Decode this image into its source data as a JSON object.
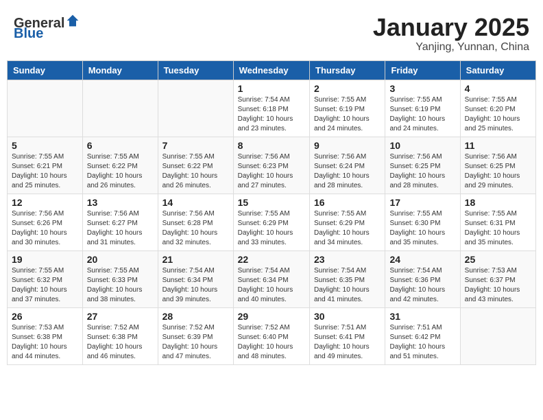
{
  "header": {
    "logo_general": "General",
    "logo_blue": "Blue",
    "month_title": "January 2025",
    "subtitle": "Yanjing, Yunnan, China"
  },
  "weekdays": [
    "Sunday",
    "Monday",
    "Tuesday",
    "Wednesday",
    "Thursday",
    "Friday",
    "Saturday"
  ],
  "weeks": [
    [
      {
        "day": "",
        "info": ""
      },
      {
        "day": "",
        "info": ""
      },
      {
        "day": "",
        "info": ""
      },
      {
        "day": "1",
        "info": "Sunrise: 7:54 AM\nSunset: 6:18 PM\nDaylight: 10 hours\nand 23 minutes."
      },
      {
        "day": "2",
        "info": "Sunrise: 7:55 AM\nSunset: 6:19 PM\nDaylight: 10 hours\nand 24 minutes."
      },
      {
        "day": "3",
        "info": "Sunrise: 7:55 AM\nSunset: 6:19 PM\nDaylight: 10 hours\nand 24 minutes."
      },
      {
        "day": "4",
        "info": "Sunrise: 7:55 AM\nSunset: 6:20 PM\nDaylight: 10 hours\nand 25 minutes."
      }
    ],
    [
      {
        "day": "5",
        "info": "Sunrise: 7:55 AM\nSunset: 6:21 PM\nDaylight: 10 hours\nand 25 minutes."
      },
      {
        "day": "6",
        "info": "Sunrise: 7:55 AM\nSunset: 6:22 PM\nDaylight: 10 hours\nand 26 minutes."
      },
      {
        "day": "7",
        "info": "Sunrise: 7:55 AM\nSunset: 6:22 PM\nDaylight: 10 hours\nand 26 minutes."
      },
      {
        "day": "8",
        "info": "Sunrise: 7:56 AM\nSunset: 6:23 PM\nDaylight: 10 hours\nand 27 minutes."
      },
      {
        "day": "9",
        "info": "Sunrise: 7:56 AM\nSunset: 6:24 PM\nDaylight: 10 hours\nand 28 minutes."
      },
      {
        "day": "10",
        "info": "Sunrise: 7:56 AM\nSunset: 6:25 PM\nDaylight: 10 hours\nand 28 minutes."
      },
      {
        "day": "11",
        "info": "Sunrise: 7:56 AM\nSunset: 6:25 PM\nDaylight: 10 hours\nand 29 minutes."
      }
    ],
    [
      {
        "day": "12",
        "info": "Sunrise: 7:56 AM\nSunset: 6:26 PM\nDaylight: 10 hours\nand 30 minutes."
      },
      {
        "day": "13",
        "info": "Sunrise: 7:56 AM\nSunset: 6:27 PM\nDaylight: 10 hours\nand 31 minutes."
      },
      {
        "day": "14",
        "info": "Sunrise: 7:56 AM\nSunset: 6:28 PM\nDaylight: 10 hours\nand 32 minutes."
      },
      {
        "day": "15",
        "info": "Sunrise: 7:55 AM\nSunset: 6:29 PM\nDaylight: 10 hours\nand 33 minutes."
      },
      {
        "day": "16",
        "info": "Sunrise: 7:55 AM\nSunset: 6:29 PM\nDaylight: 10 hours\nand 34 minutes."
      },
      {
        "day": "17",
        "info": "Sunrise: 7:55 AM\nSunset: 6:30 PM\nDaylight: 10 hours\nand 35 minutes."
      },
      {
        "day": "18",
        "info": "Sunrise: 7:55 AM\nSunset: 6:31 PM\nDaylight: 10 hours\nand 35 minutes."
      }
    ],
    [
      {
        "day": "19",
        "info": "Sunrise: 7:55 AM\nSunset: 6:32 PM\nDaylight: 10 hours\nand 37 minutes."
      },
      {
        "day": "20",
        "info": "Sunrise: 7:55 AM\nSunset: 6:33 PM\nDaylight: 10 hours\nand 38 minutes."
      },
      {
        "day": "21",
        "info": "Sunrise: 7:54 AM\nSunset: 6:34 PM\nDaylight: 10 hours\nand 39 minutes."
      },
      {
        "day": "22",
        "info": "Sunrise: 7:54 AM\nSunset: 6:34 PM\nDaylight: 10 hours\nand 40 minutes."
      },
      {
        "day": "23",
        "info": "Sunrise: 7:54 AM\nSunset: 6:35 PM\nDaylight: 10 hours\nand 41 minutes."
      },
      {
        "day": "24",
        "info": "Sunrise: 7:54 AM\nSunset: 6:36 PM\nDaylight: 10 hours\nand 42 minutes."
      },
      {
        "day": "25",
        "info": "Sunrise: 7:53 AM\nSunset: 6:37 PM\nDaylight: 10 hours\nand 43 minutes."
      }
    ],
    [
      {
        "day": "26",
        "info": "Sunrise: 7:53 AM\nSunset: 6:38 PM\nDaylight: 10 hours\nand 44 minutes."
      },
      {
        "day": "27",
        "info": "Sunrise: 7:52 AM\nSunset: 6:38 PM\nDaylight: 10 hours\nand 46 minutes."
      },
      {
        "day": "28",
        "info": "Sunrise: 7:52 AM\nSunset: 6:39 PM\nDaylight: 10 hours\nand 47 minutes."
      },
      {
        "day": "29",
        "info": "Sunrise: 7:52 AM\nSunset: 6:40 PM\nDaylight: 10 hours\nand 48 minutes."
      },
      {
        "day": "30",
        "info": "Sunrise: 7:51 AM\nSunset: 6:41 PM\nDaylight: 10 hours\nand 49 minutes."
      },
      {
        "day": "31",
        "info": "Sunrise: 7:51 AM\nSunset: 6:42 PM\nDaylight: 10 hours\nand 51 minutes."
      },
      {
        "day": "",
        "info": ""
      }
    ]
  ]
}
